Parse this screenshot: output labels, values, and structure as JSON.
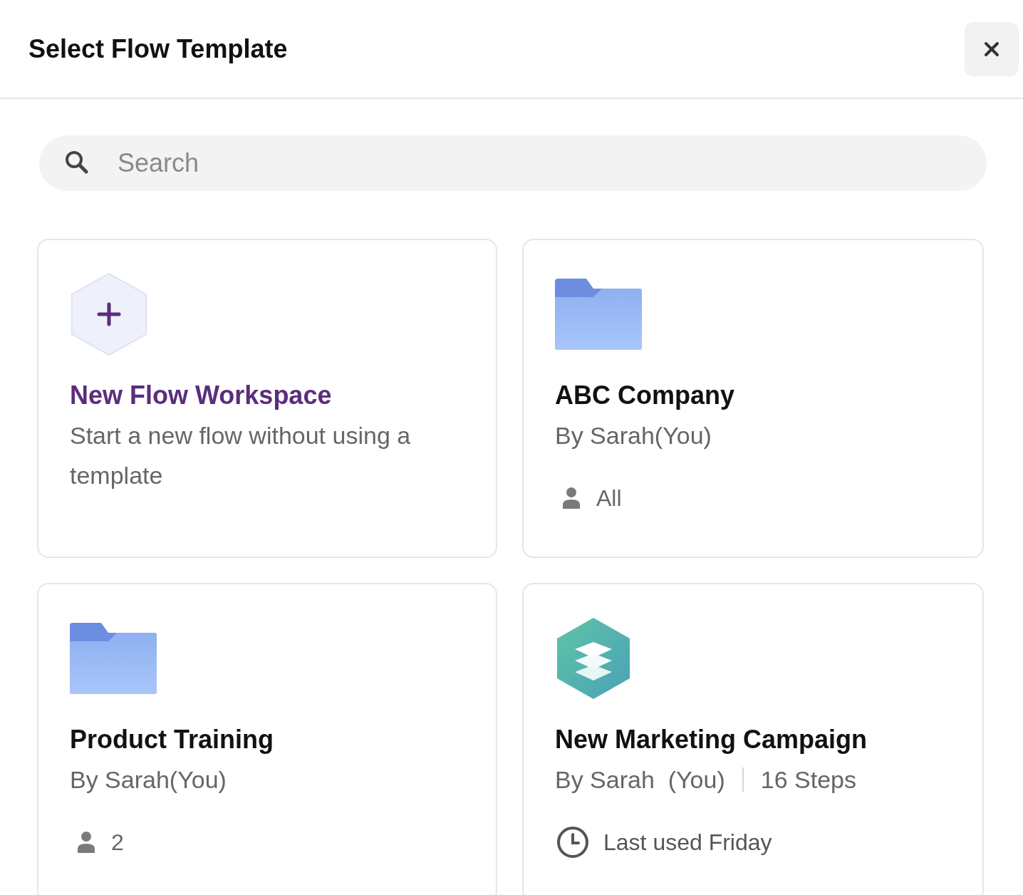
{
  "dialog": {
    "title": "Select Flow Template"
  },
  "search": {
    "placeholder": "Search"
  },
  "cards": [
    {
      "kind": "new",
      "title": "New Flow Workspace",
      "description": "Start a new flow without using a template"
    },
    {
      "kind": "folder",
      "title": "ABC Company",
      "byline": "By Sarah(You)",
      "meta": {
        "kind": "person",
        "text": "All"
      }
    },
    {
      "kind": "folder",
      "title": "Product Training",
      "byline": "By Sarah(You)",
      "meta": {
        "kind": "person",
        "text": "2"
      }
    },
    {
      "kind": "app",
      "title": "New Marketing Campaign",
      "byline": "By Sarah  (You)",
      "steps": "16 Steps",
      "meta": {
        "kind": "clock",
        "text": "Last used Friday"
      }
    }
  ]
}
